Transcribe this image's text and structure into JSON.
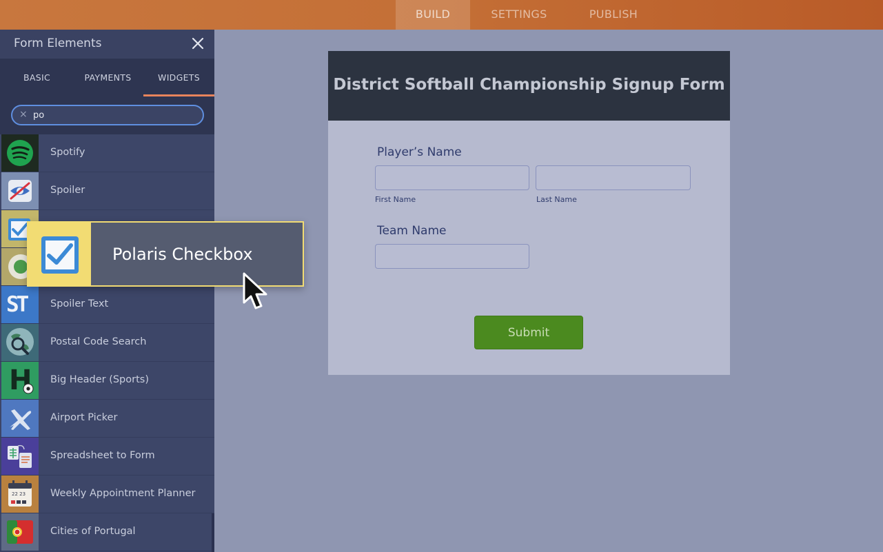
{
  "topbar": {
    "tabs": [
      {
        "label": "BUILD",
        "active": true
      },
      {
        "label": "SETTINGS",
        "active": false
      },
      {
        "label": "PUBLISH",
        "active": false
      }
    ]
  },
  "sidebar": {
    "title": "Form Elements",
    "tabs": [
      {
        "label": "BASIC",
        "active": false
      },
      {
        "label": "PAYMENTS",
        "active": false
      },
      {
        "label": "WIDGETS",
        "active": true
      }
    ],
    "search": {
      "value": "po",
      "clear_icon": "×"
    },
    "items": [
      {
        "label": "Spotify",
        "icon": "spotify-icon"
      },
      {
        "label": "Spoiler",
        "icon": "spoiler-icon"
      },
      {
        "label": "",
        "icon": "checkbox-icon"
      },
      {
        "label": "",
        "icon": "radio-icon"
      },
      {
        "label": "Spoiler Text",
        "icon": "spoiler-text-icon",
        "icon_text": "ST"
      },
      {
        "label": "Postal Code Search",
        "icon": "postal-globe-icon"
      },
      {
        "label": "Big Header (Sports)",
        "icon": "big-header-icon",
        "icon_text": "H"
      },
      {
        "label": "Airport Picker",
        "icon": "airplane-icon"
      },
      {
        "label": "Spreadsheet to Form",
        "icon": "spreadsheet-icon"
      },
      {
        "label": "Weekly Appointment Planner",
        "icon": "calendar-icon",
        "icon_text": "22 23"
      },
      {
        "label": "Cities of Portugal",
        "icon": "portugal-flag-icon"
      }
    ]
  },
  "drag": {
    "label": "Polaris Checkbox",
    "icon": "checkbox-icon"
  },
  "form": {
    "title": "District Softball Championship Signup Form",
    "players_name_label": "Player’s Name",
    "first_name_sublabel": "First Name",
    "last_name_sublabel": "Last Name",
    "team_name_label": "Team Name",
    "submit_label": "Submit"
  },
  "colors": {
    "topbar": "#c46f36",
    "sidebar": "#3d4668",
    "canvas": "#8f96b1",
    "form_header": "#2c3340",
    "submit": "#4b8a1f",
    "drag_highlight": "#f2dc73",
    "active_tab_underline": "#e9845c"
  }
}
